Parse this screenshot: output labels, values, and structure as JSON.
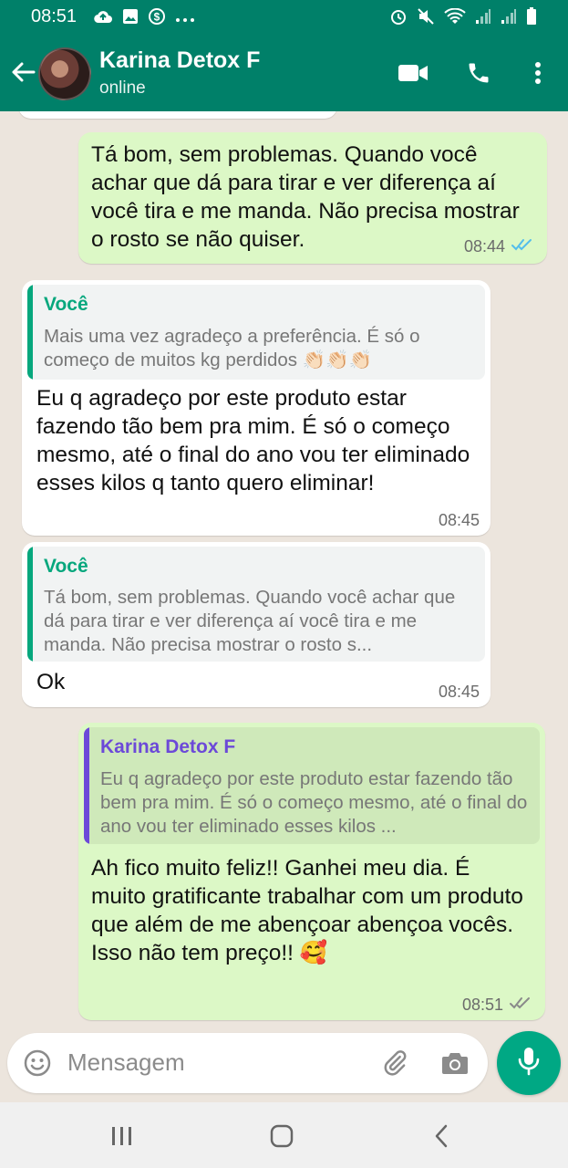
{
  "status_bar": {
    "time": "08:51",
    "icons_left": [
      "cloud-upload-icon",
      "image-icon",
      "dollar-icon",
      "more-dots-icon"
    ],
    "icons_right": [
      "alarm-icon",
      "mute-icon",
      "wifi-icon",
      "signal-icon",
      "signal-icon",
      "battery-icon"
    ]
  },
  "header": {
    "contact_name": "Karina Detox F",
    "status": "online",
    "icons": [
      "back-arrow-icon",
      "video-call-icon",
      "phone-icon",
      "more-vert-icon"
    ]
  },
  "colors": {
    "header": "#008069",
    "outgoing_bubble": "#dcf8c6",
    "incoming_bubble": "#ffffff",
    "chat_background": "#ece5dd",
    "quote_you": "#06a77d",
    "quote_contact": "#6c49d8",
    "mic_button": "#00a884",
    "read_tick": "#53bdeb"
  },
  "messages": [
    {
      "direction": "out",
      "text": "Tá bom, sem problemas. Quando você achar que dá para tirar e ver diferença aí você tira e me manda. Não precisa mostrar o rosto se não quiser.",
      "time": "08:44",
      "status": "read"
    },
    {
      "direction": "in",
      "quote_author": "Você",
      "quote_text": "Mais uma vez agradeço a preferência. É só o começo de muitos kg perdidos 👏🏻👏🏻👏🏻",
      "text": "Eu q agradeço por este produto estar fazendo tão bem pra mim. É só o começo mesmo, até o final do ano vou ter eliminado esses kilos q tanto quero eliminar!",
      "time": "08:45"
    },
    {
      "direction": "in",
      "quote_author": "Você",
      "quote_text": "Tá bom, sem problemas. Quando você achar que dá para tirar e ver diferença aí você tira e me manda. Não precisa mostrar o rosto s...",
      "text": "Ok",
      "time": "08:45"
    },
    {
      "direction": "out",
      "quote_author": "Karina Detox F",
      "quote_text": "Eu q agradeço por este produto estar fazendo tão bem pra mim. É só o começo mesmo, até o final do ano vou ter eliminado esses kilos ...",
      "text": "Ah fico muito feliz!! Ganhei meu dia. É muito gratificante trabalhar com um produto que além de me abençoar abençoa vocês. Isso não tem preço!! 🥰",
      "time": "08:51",
      "status": "delivered"
    }
  ],
  "composer": {
    "placeholder": "Mensagem",
    "icons": [
      "emoji-icon",
      "attach-icon",
      "camera-icon",
      "mic-icon"
    ]
  },
  "navigation": {
    "icons": [
      "recent-apps-icon",
      "home-icon",
      "back-icon"
    ]
  }
}
